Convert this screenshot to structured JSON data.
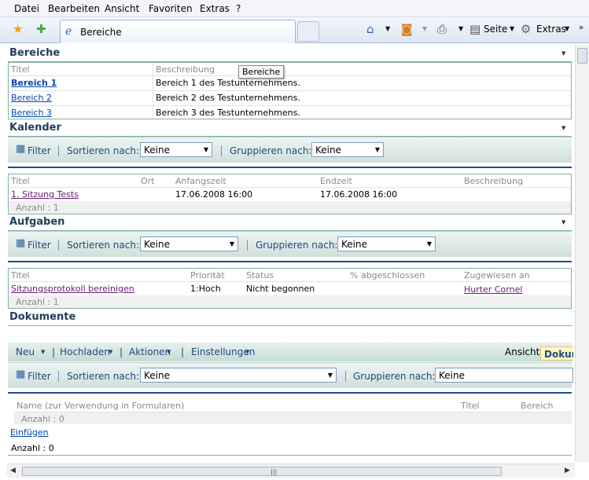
{
  "menu": [
    "Datei",
    "Bearbeiten",
    "Ansicht",
    "Favoriten",
    "Extras",
    "?"
  ],
  "toolbar": {
    "tab_title": "Bereiche",
    "seite_label": "Seite",
    "extras_label": "Extras"
  },
  "tooltip": "Bereiche",
  "bereiche": {
    "title": "Bereiche",
    "headers": [
      "Titel",
      "Beschreibung"
    ],
    "rows": [
      {
        "title": "Bereich 1",
        "desc": "Bereich 1 des Testunternehmens."
      },
      {
        "title": "Bereich 2",
        "desc": "Bereich 2 des Testunternehmens."
      },
      {
        "title": "Bereich 3",
        "desc": "Bereich 3 des Testunternehmens."
      }
    ]
  },
  "filterbar": {
    "filter": "Filter",
    "sort": "Sortieren nach:",
    "group": "Gruppieren nach:",
    "value": "Keine"
  },
  "kalender": {
    "title": "Kalender",
    "headers": [
      "Titel",
      "Ort",
      "Anfangszeit",
      "Endzeit",
      "Beschreibung"
    ],
    "row": {
      "title": "1. Sitzung Tests",
      "ort": "",
      "start": "17.06.2008 16:00",
      "end": "17.06.2008 16:00",
      "desc": ""
    },
    "count": "Anzahl : 1"
  },
  "aufgaben": {
    "title": "Aufgaben",
    "headers": [
      "Titel",
      "Priorität",
      "Status",
      "% abgeschlossen",
      "Zugewiesen an"
    ],
    "row": {
      "title": "Sitzungsprotokoll bereinigen",
      "prio": "1:Hoch",
      "status": "Nicht begonnen",
      "pct": "",
      "assigned": "Hurter Cornel"
    },
    "count": "Anzahl : 1"
  },
  "dokumente": {
    "title": "Dokumente",
    "toolbar": {
      "neu": "Neu",
      "hochladen": "Hochladen",
      "aktionen": "Aktionen",
      "einstellungen": "Einstellungen",
      "ansicht": "Ansicht:",
      "ansicht_value": "Dokum"
    },
    "headers": [
      "Name (zur Verwendung in Formularen)",
      "Titel",
      "Bereich"
    ],
    "count_inner": "Anzahl : 0",
    "einfuegen": "Einfügen",
    "count": "Anzahl : 0"
  }
}
